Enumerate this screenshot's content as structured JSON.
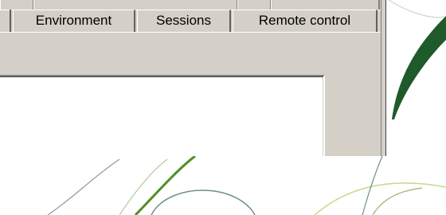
{
  "tabs": [
    {
      "label": "Environment"
    },
    {
      "label": "Sessions"
    },
    {
      "label": "Remote control"
    }
  ],
  "colors": {
    "dialog_face": "#d4d0c8",
    "wallpaper_green_dark": "#1f5a2a",
    "wallpaper_green_light": "#8cc63f",
    "wallpaper_line_grey": "#7a8a8a"
  }
}
